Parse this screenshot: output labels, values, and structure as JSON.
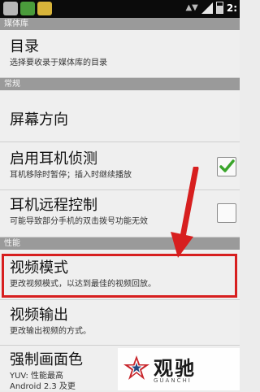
{
  "status_bar": {
    "time": "2:"
  },
  "sections": {
    "library": "媒体库",
    "general": "常规",
    "performance": "性能"
  },
  "items": {
    "directory": {
      "title": "目录",
      "subtitle": "选择要收录于媒体库的目录"
    },
    "orientation": {
      "title": "屏幕方向"
    },
    "headset_detect": {
      "title": "启用耳机侦测",
      "subtitle": "耳机移除时暂停；插入时继续播放",
      "checked": true
    },
    "headset_remote": {
      "title": "耳机远程控制",
      "subtitle": "可能导致部分手机的双击拨号功能无效",
      "checked": false
    },
    "video_mode": {
      "title": "视频模式",
      "subtitle": "更改视频模式，以达到最佳的视频回放。"
    },
    "video_output": {
      "title": "视频输出",
      "subtitle": "更改输出视频的方式。"
    },
    "force_render": {
      "title": "强制画面色",
      "subtitle": "YUV: 性能最高",
      "subtitle2": "Android 2.3 及更"
    }
  },
  "annotation": {
    "highlight_color": "#d71f1f"
  },
  "watermark": {
    "name": "观驰",
    "sub": "GUANCHI"
  }
}
